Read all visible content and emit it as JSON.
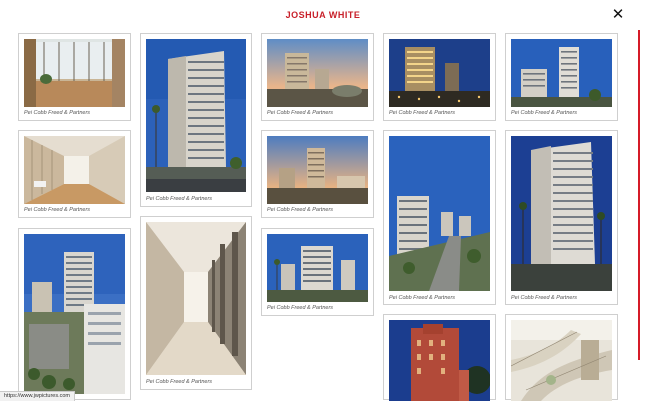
{
  "header": {
    "title": "JOSHUA WHITE",
    "close_label": "✕"
  },
  "gallery": {
    "caption": "Pei Cobb Freed & Partners",
    "photos": [
      {
        "subject": "lobby-interior-photo"
      },
      {
        "subject": "office-tower-photo"
      },
      {
        "subject": "tower-sunset-photo"
      },
      {
        "subject": "tower-night-photo"
      },
      {
        "subject": "twin-towers-photo"
      },
      {
        "subject": "atrium-interior-photo"
      },
      {
        "subject": "tower-dusk-photo"
      },
      {
        "subject": "tower-aerial-photo"
      },
      {
        "subject": "tower-palms-photo"
      },
      {
        "subject": "tower-campus-photo"
      },
      {
        "subject": "colonnade-photo"
      },
      {
        "subject": "towers-cluster-photo"
      },
      {
        "subject": "red-building-photo"
      },
      {
        "subject": "stair-interior-photo"
      }
    ]
  },
  "status_bar": {
    "url": "https://www.jwpictures.com"
  },
  "colors": {
    "accent": "#c8202a",
    "scroll_line": "#d51b28",
    "sky": "#2d62b8"
  }
}
